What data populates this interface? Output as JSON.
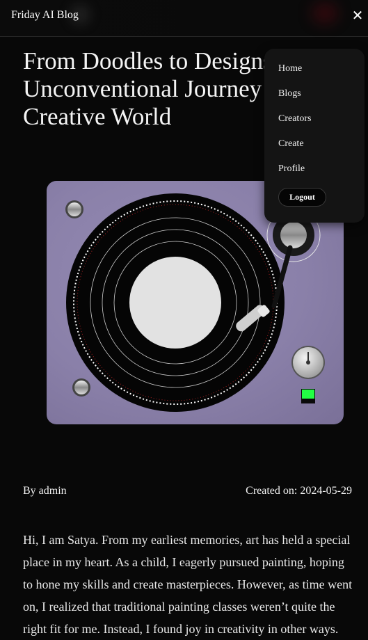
{
  "header": {
    "brand": "Friday AI Blog",
    "close_icon": "close-icon"
  },
  "post": {
    "title": "From Doodles to Designs: My Unconventional Journey into the Creative World",
    "hero_image": "turntable-illustration",
    "author": "By admin",
    "created_label": "Created on: 2024-05-29",
    "body": "Hi, I am Satya. From my earliest memories, art has held a special place in my heart. As a child, I eagerly pursued painting, hoping to hone my skills and create masterpieces. However, as time went on, I realized that traditional painting classes weren’t quite the right fit for me. Instead, I found joy in creativity in other ways."
  },
  "menu": {
    "items": [
      "Home",
      "Blogs",
      "Creators",
      "Create",
      "Profile"
    ],
    "logout": "Logout"
  },
  "colors": {
    "background": "#080808",
    "hero_card": "#8b81aa",
    "indicator": "#22ff44"
  }
}
